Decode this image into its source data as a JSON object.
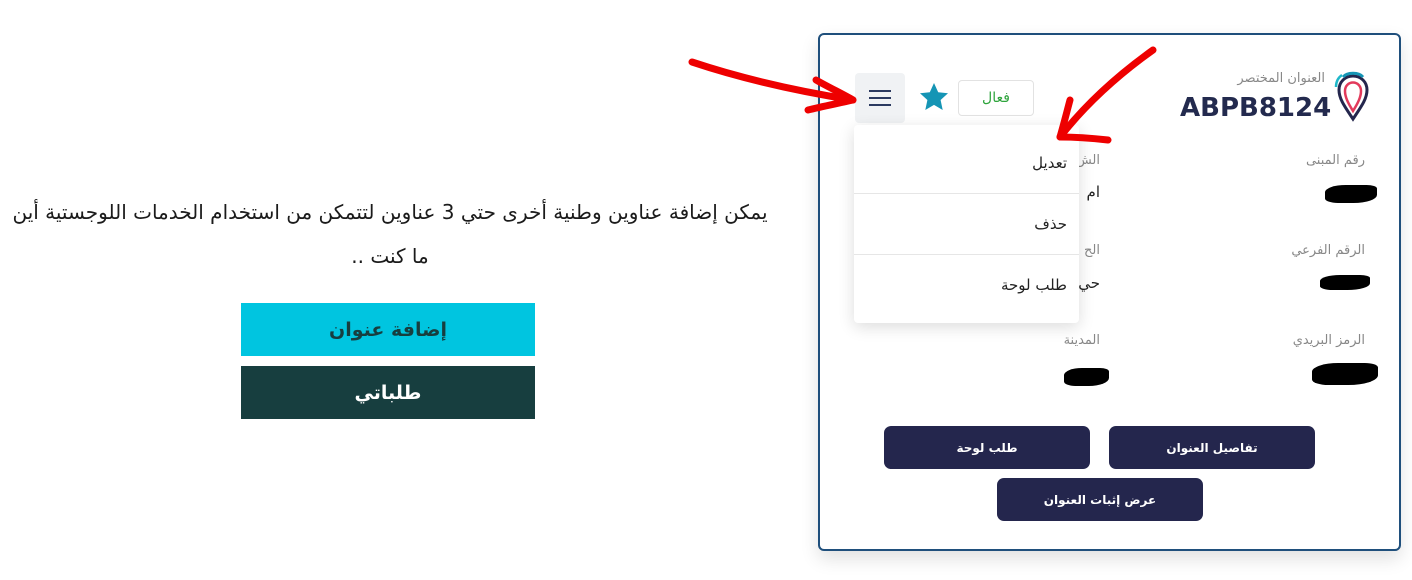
{
  "info": {
    "message": "يمكن إضافة عناوين وطنية أخرى حتي 3 عناوين لتتمكن من استخدام الخدمات اللوجستية أين ما كنت ..",
    "add_button": "إضافة عنوان",
    "orders_button": "طلباتي"
  },
  "card": {
    "short_address_label": "العنوان المختصر",
    "short_address": "ABPB8124",
    "status": "فعال",
    "fields": {
      "building_number_label": "رقم المبنى",
      "street_label": "الش",
      "street_value": "ام",
      "secondary_number_label": "الرقم الفرعي",
      "district_label": "الح",
      "district_value": "حي",
      "postal_code_label": "الرمز البريدي",
      "city_label": "المدينة"
    },
    "buttons": {
      "address_details": "تفاصيل العنوان",
      "request_plate": "طلب لوحة",
      "show_proof": "عرض إثبات العنوان"
    }
  },
  "menu": {
    "items": [
      "تعديل",
      "حذف",
      "طلب لوحة"
    ]
  },
  "colors": {
    "accent_cyan": "#00c5e0",
    "dark_teal": "#173e3f",
    "navy_button": "#24264d",
    "status_green": "#2ea43c",
    "star_teal": "#1595b5",
    "annotation_red": "#ee0000"
  },
  "icons": [
    "location-pin-logo-icon",
    "star-icon",
    "hamburger-menu-icon"
  ]
}
